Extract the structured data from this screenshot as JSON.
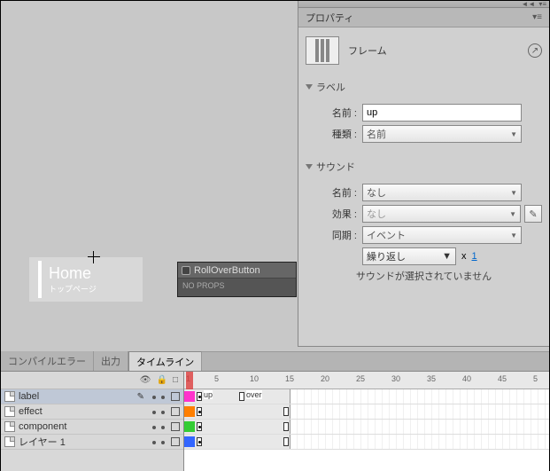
{
  "stage": {
    "home_title": "Home",
    "home_sub": "トップページ",
    "rollover_title": "RollOverButton",
    "rollover_body": "NO PROPS"
  },
  "panel": {
    "title": "プロパティ",
    "frame_label": "フレーム",
    "sections": {
      "label": {
        "title": "ラベル",
        "name_lbl": "名前 :",
        "name_val": "up",
        "type_lbl": "種類 :",
        "type_val": "名前"
      },
      "sound": {
        "title": "サウンド",
        "name_lbl": "名前 :",
        "name_val": "なし",
        "effect_lbl": "効果 :",
        "effect_val": "なし",
        "sync_lbl": "同期 :",
        "sync_val": "イベント",
        "repeat_val": "繰り返し",
        "x_label": "x",
        "x_val": "1",
        "msg": "サウンドが選択されていません"
      }
    }
  },
  "bottom": {
    "tabs": {
      "compile": "コンパイルエラー",
      "output": "出力",
      "timeline": "タイムライン"
    },
    "ruler": [
      "1",
      "5",
      "10",
      "15",
      "20",
      "25",
      "30",
      "35",
      "40",
      "45",
      "5"
    ],
    "layers": [
      {
        "name": "label",
        "color": "#ff33cc",
        "selected": true,
        "pencil": true
      },
      {
        "name": "effect",
        "color": "#ff7f00",
        "selected": false,
        "pencil": false
      },
      {
        "name": "component",
        "color": "#33cc33",
        "selected": false,
        "pencil": false
      },
      {
        "name": "レイヤー 1",
        "color": "#3366ff",
        "selected": false,
        "pencil": false
      }
    ],
    "frame_labels": {
      "up": "up",
      "over": "over"
    }
  }
}
